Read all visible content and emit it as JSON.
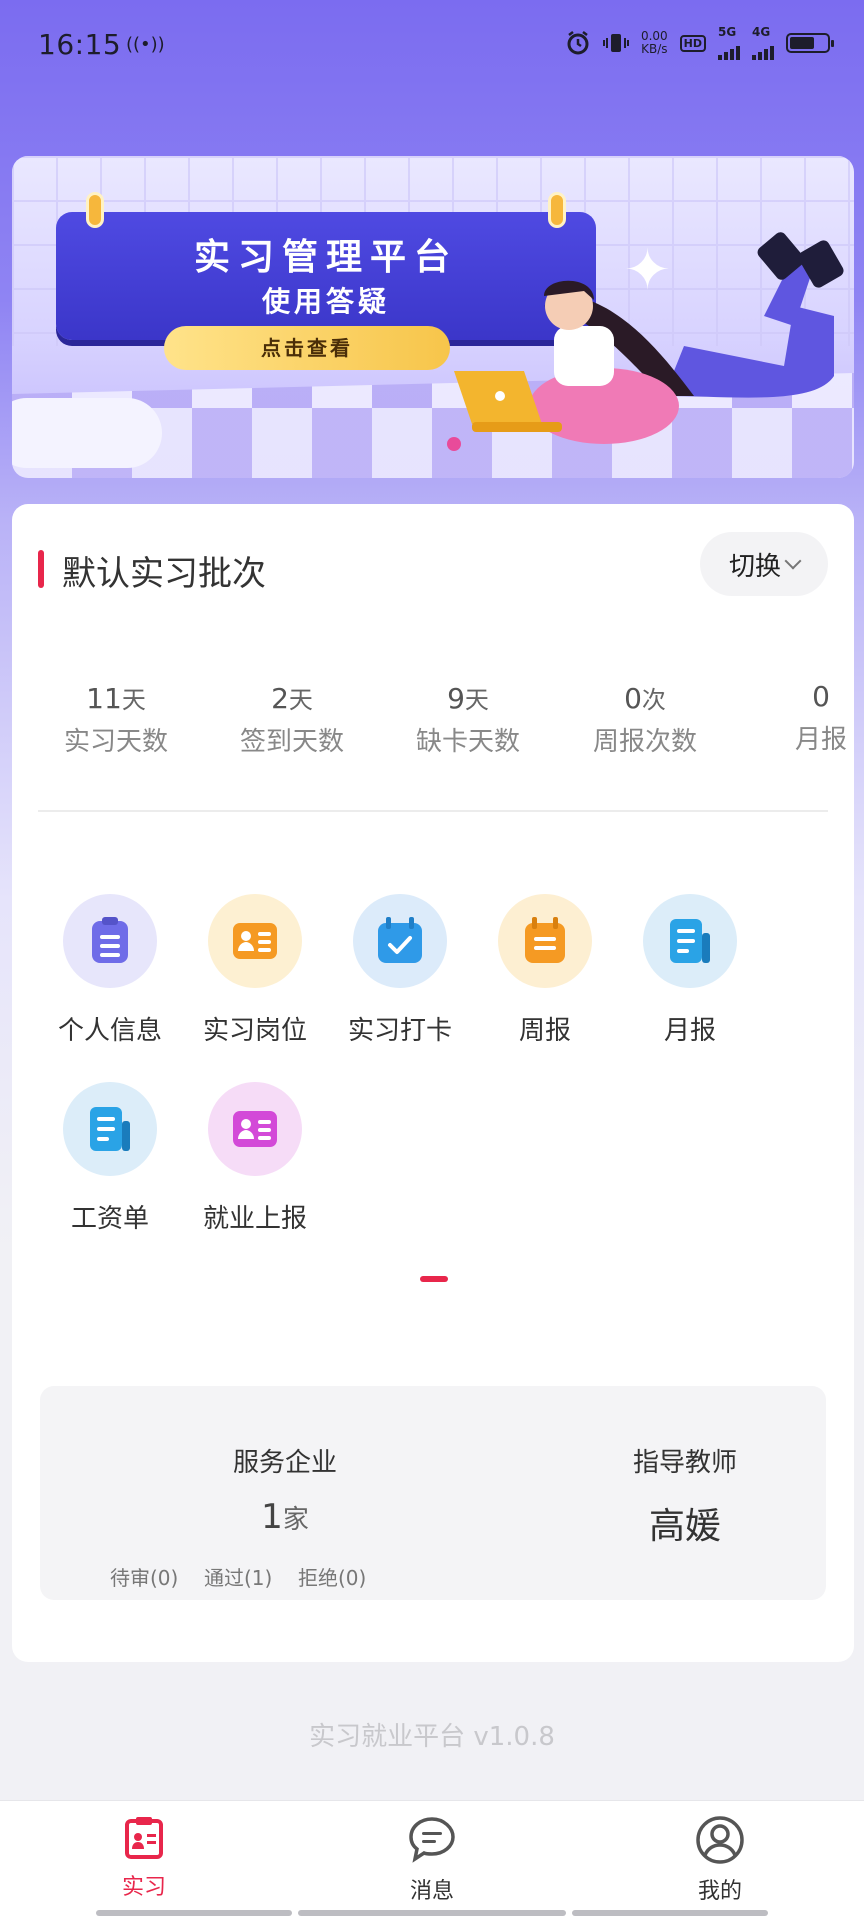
{
  "status_bar": {
    "time": "16:15",
    "speed_value": "0.00",
    "speed_unit": "KB/s",
    "hd_label": "HD",
    "sim1": "5G",
    "sim2": "4G"
  },
  "banner": {
    "title": "实习管理平台",
    "subtitle": "使用答疑",
    "button_label": "点击查看"
  },
  "batch": {
    "title": "默认实习批次",
    "switch_label": "切换"
  },
  "stats": [
    {
      "value": "11",
      "unit": "天",
      "label": "实习天数"
    },
    {
      "value": "2",
      "unit": "天",
      "label": "签到天数"
    },
    {
      "value": "9",
      "unit": "天",
      "label": "缺卡天数"
    },
    {
      "value": "0",
      "unit": "次",
      "label": "周报次数"
    },
    {
      "value": "0",
      "unit": "",
      "label": "月报"
    }
  ],
  "functions": [
    {
      "label": "个人信息",
      "icon": "clipboard-icon",
      "color": "#6f6ce8",
      "bg": "#e7e6fb"
    },
    {
      "label": "实习岗位",
      "icon": "id-card-icon",
      "color": "#f59a23",
      "bg": "#fdf0d2"
    },
    {
      "label": "实习打卡",
      "icon": "calendar-check-icon",
      "color": "#2f9ae8",
      "bg": "#dcebfa"
    },
    {
      "label": "周报",
      "icon": "report-icon",
      "color": "#f59a23",
      "bg": "#fdefd2"
    },
    {
      "label": "月报",
      "icon": "document-icon",
      "color": "#2aa3e6",
      "bg": "#dcedf9"
    },
    {
      "label": "工资单",
      "icon": "document-icon",
      "color": "#2aa3e6",
      "bg": "#dcedf9"
    },
    {
      "label": "就业上报",
      "icon": "id-card-icon",
      "color": "#d34ad8",
      "bg": "#f6dcf7"
    }
  ],
  "service": {
    "title": "服务企业",
    "count": "1",
    "unit": "家",
    "pending": "待审(0)",
    "approved": "通过(1)",
    "rejected": "拒绝(0)"
  },
  "teacher": {
    "title": "指导教师",
    "name": "高媛"
  },
  "version": "实习就业平台 v1.0.8",
  "tabs": [
    {
      "label": "实习",
      "icon": "internship-icon",
      "active": true
    },
    {
      "label": "消息",
      "icon": "message-icon",
      "active": false
    },
    {
      "label": "我的",
      "icon": "profile-icon",
      "active": false
    }
  ],
  "colors": {
    "accent": "#e8264b",
    "banner_sign": "#4f4ae2",
    "background_top": "#7b6cf0"
  }
}
